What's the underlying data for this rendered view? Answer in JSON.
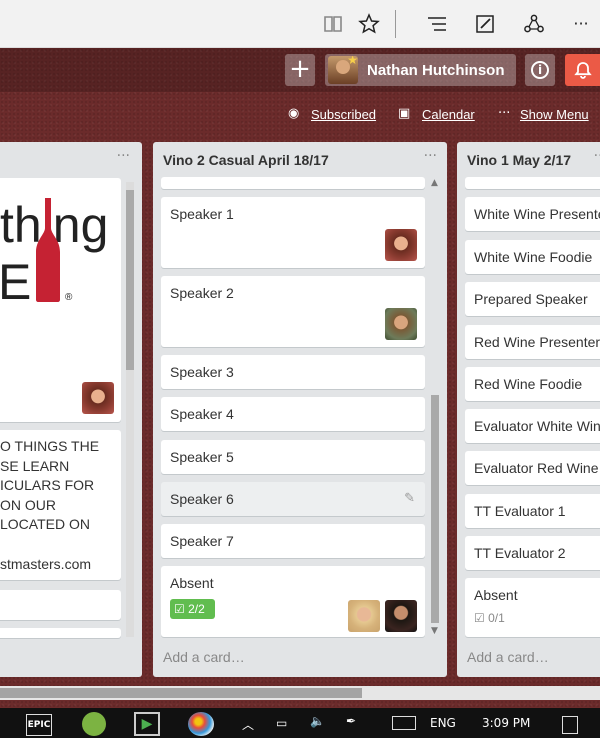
{
  "browser": {
    "icons": [
      "reading-view-icon",
      "favorite-star-icon",
      "hub-icon",
      "web-note-icon",
      "share-icon",
      "more-icon"
    ],
    "more": "···"
  },
  "header": {
    "add": "+",
    "user_name": "Nathan Hutchinson",
    "info": "i",
    "notifications": "bell-icon",
    "accent_color": "#eb5a46"
  },
  "board_menu": {
    "subscribed": "Subscribed",
    "calendar": "Calendar",
    "show_menu": "Show Menu",
    "menu_dots": "···"
  },
  "lists": {
    "left": {
      "logo_text": "thing",
      "logo_e": "E",
      "reg": "®",
      "desc": [
        "O THINGS THE",
        "SE LEARN",
        "ICULARS FOR",
        "ON OUR",
        "LOCATED ON",
        "",
        "stmasters.com"
      ],
      "menu": "···"
    },
    "middle": {
      "title": "Vino 2 Casual April 18/17",
      "menu": "···",
      "cards": [
        {
          "title": "Speaker 1"
        },
        {
          "title": "Speaker 2"
        },
        {
          "title": "Speaker 3"
        },
        {
          "title": "Speaker 4"
        },
        {
          "title": "Speaker 5"
        },
        {
          "title": "Speaker 6"
        },
        {
          "title": "Speaker 7"
        },
        {
          "title": "Absent",
          "checklist": "2/2"
        }
      ],
      "add_card": "Add a card…"
    },
    "right": {
      "title": "Vino 1 May 2/17",
      "menu": "···",
      "cards": [
        {
          "title": "White Wine Presenter"
        },
        {
          "title": "White Wine Foodie"
        },
        {
          "title": "Prepared Speaker"
        },
        {
          "title": "Red Wine Presenter"
        },
        {
          "title": "Red Wine Foodie"
        },
        {
          "title": "Evaluator White Wine"
        },
        {
          "title": "Evaluator Red Wine"
        },
        {
          "title": "TT Evaluator 1"
        },
        {
          "title": "TT Evaluator 2"
        },
        {
          "title": "Absent",
          "checklist": "0/1"
        }
      ],
      "add_card": "Add a card…"
    }
  },
  "taskbar": {
    "epic": "EPIC",
    "language": "ENG",
    "time": "3:09 PM"
  }
}
